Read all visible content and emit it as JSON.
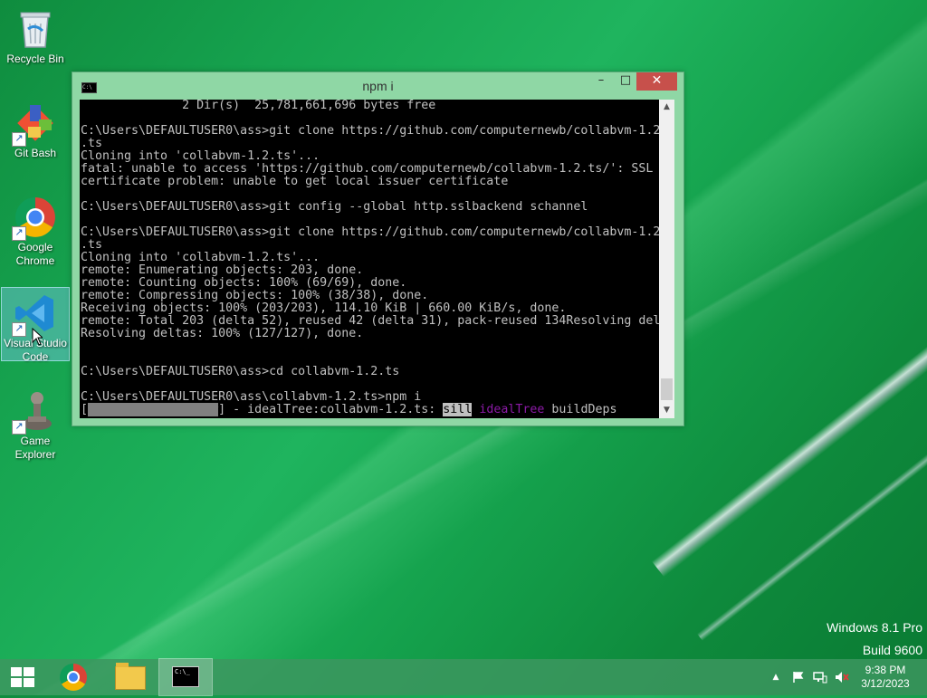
{
  "desktop": {
    "icons": [
      {
        "label": "Recycle Bin"
      },
      {
        "label": "Git Bash"
      },
      {
        "label": "Google Chrome"
      },
      {
        "label": "Visual Studio Code"
      },
      {
        "label": "Game Explorer"
      }
    ],
    "watermark": {
      "line1": "Windows 8.1 Pro",
      "line2": "Build 9600"
    }
  },
  "window": {
    "title": "npm i",
    "buttons": {
      "minimize": "–",
      "maximize": "□",
      "close": "✕"
    },
    "console_lines": [
      "              2 Dir(s)  25,781,661,696 bytes free",
      "",
      "C:\\Users\\DEFAULTUSER0\\ass>git clone https://github.com/computernewb/collabvm-1.2",
      ".ts",
      "Cloning into 'collabvm-1.2.ts'...",
      "fatal: unable to access 'https://github.com/computernewb/collabvm-1.2.ts/': SSL",
      "certificate problem: unable to get local issuer certificate",
      "",
      "C:\\Users\\DEFAULTUSER0\\ass>git config --global http.sslbackend schannel",
      "",
      "C:\\Users\\DEFAULTUSER0\\ass>git clone https://github.com/computernewb/collabvm-1.2",
      ".ts",
      "Cloning into 'collabvm-1.2.ts'...",
      "remote: Enumerating objects: 203, done.",
      "remote: Counting objects: 100% (69/69), done.",
      "remote: Compressing objects: 100% (38/38), done.",
      "Receiving objects: 100% (203/203), 114.10 KiB | 660.00 KiB/s, done.",
      "remote: Total 203 (delta 52), reused 42 (delta 31), pack-reused 134Resolving del",
      "Resolving deltas: 100% (127/127), done.",
      "",
      "",
      "C:\\Users\\DEFAULTUSER0\\ass>cd collabvm-1.2.ts",
      "",
      "C:\\Users\\DEFAULTUSER0\\ass\\collabvm-1.2.ts>npm i"
    ],
    "progress": {
      "open": "[",
      "bar": "##################",
      "rest": "] - idealTree:collabvm-1.2.ts: ",
      "level": "sill",
      "stage": "idealTree",
      "task": "buildDeps"
    }
  },
  "taskbar": {
    "clock_time": "9:38 PM",
    "clock_date": "3/12/2023",
    "tray_chevron": "▲"
  }
}
